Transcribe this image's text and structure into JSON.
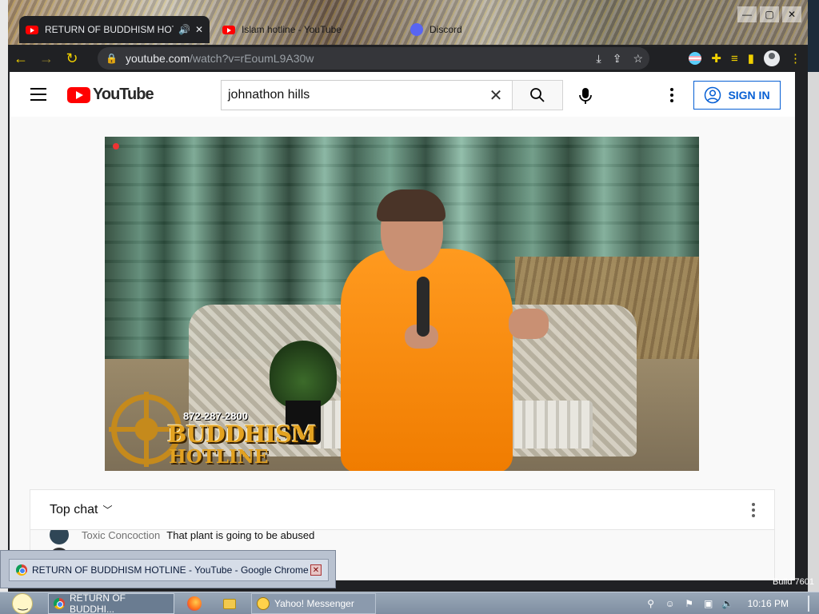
{
  "browser": {
    "tabs": [
      {
        "title": "RETURN OF BUDDHISM HOTLINE - YouTube",
        "active": true,
        "favicon": "youtube-icon"
      },
      {
        "title": "Islam hotline - YouTube",
        "active": false,
        "favicon": "youtube-icon"
      },
      {
        "title": "Discord",
        "active": false,
        "favicon": "discord-icon"
      }
    ],
    "address": {
      "host": "youtube.com",
      "path": "/watch?v=rEoumL9A30w"
    }
  },
  "youtube": {
    "logo_text": "YouTube",
    "search_query": "johnathon hills",
    "sign_in_label": "SIGN IN",
    "video_overlay": {
      "phone": "872-287-2800",
      "brand_line1": "BUDDHISM",
      "brand_line2": "HOTLINE"
    },
    "chat": {
      "title": "Top chat",
      "messages": [
        {
          "author": "Toxic Concoction",
          "text": "That plant is going to be abused"
        }
      ]
    }
  },
  "taskbar": {
    "tooltip": "RETURN OF BUDDHISM HOTLINE - YouTube - Google Chrome",
    "items": [
      {
        "label": "RETURN OF BUDDHI...",
        "active": true
      },
      {
        "label": "Yahoo! Messenger",
        "active": false
      }
    ],
    "clock": "10:16 PM",
    "build": "Build 7601"
  },
  "colors": {
    "youtube_red": "#ff0000",
    "signin_blue": "#065fd4",
    "chrome_dark": "#202124",
    "accent_yellow": "#f0d000"
  }
}
